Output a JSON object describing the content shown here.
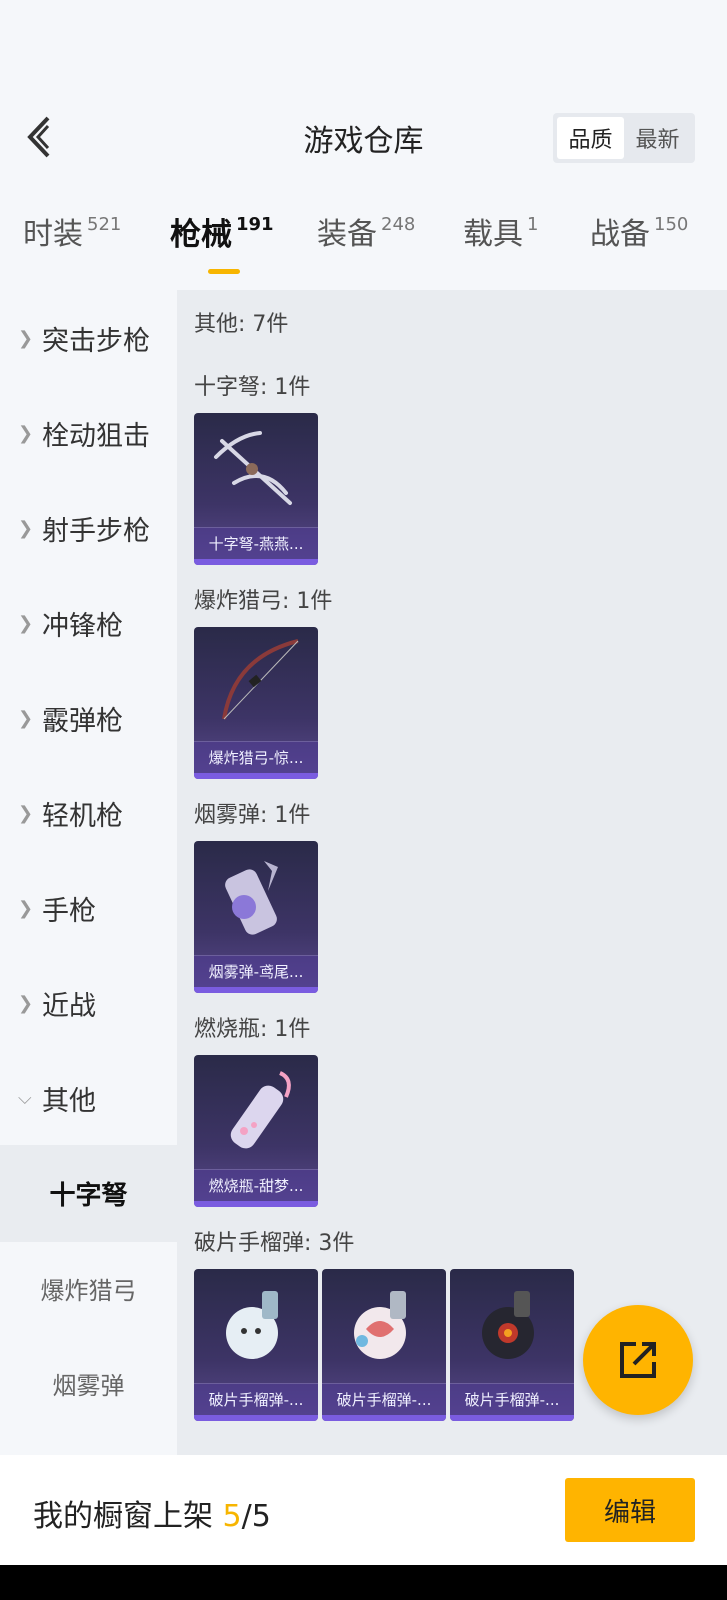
{
  "header": {
    "title": "游戏仓库",
    "sort_options": [
      "品质",
      "最新"
    ]
  },
  "tabs": [
    {
      "label": "时装",
      "count": "521"
    },
    {
      "label": "枪械",
      "count": "191"
    },
    {
      "label": "装备",
      "count": "248"
    },
    {
      "label": "载具",
      "count": "1"
    },
    {
      "label": "战备",
      "count": "150"
    }
  ],
  "sidebar": {
    "categories": [
      "突击步枪",
      "栓动狙击",
      "射手步枪",
      "冲锋枪",
      "霰弹枪",
      "轻机枪",
      "手枪",
      "近战",
      "其他"
    ],
    "subcategories": [
      "十字弩",
      "爆炸猎弓",
      "烟雾弹"
    ]
  },
  "content": {
    "summary": "其他: 7件",
    "groups": [
      {
        "title": "十字弩: 1件",
        "items": [
          "十字弩-燕燕..."
        ]
      },
      {
        "title": "爆炸猎弓: 1件",
        "items": [
          "爆炸猎弓-惊..."
        ]
      },
      {
        "title": "烟雾弹: 1件",
        "items": [
          "烟雾弹-鸢尾..."
        ]
      },
      {
        "title": "燃烧瓶: 1件",
        "items": [
          "燃烧瓶-甜梦..."
        ]
      },
      {
        "title": "破片手榴弹: 3件",
        "items": [
          "破片手榴弹-...",
          "破片手榴弹-...",
          "破片手榴弹-..."
        ]
      }
    ]
  },
  "footer": {
    "showcase_label": "我的橱窗上架",
    "showcase_current": "5",
    "showcase_sep": "/",
    "showcase_total": "5",
    "edit_label": "编辑"
  },
  "icons": {
    "back": "chevron-left-icon",
    "share": "external-link-icon",
    "expand": "chevron-right-icon",
    "collapse": "chevron-down-icon"
  },
  "colors": {
    "accent": "#ffb400",
    "tab_underline": "#f7b500",
    "card_bg": "#3d3466",
    "card_bar": "#7a5ce0"
  }
}
